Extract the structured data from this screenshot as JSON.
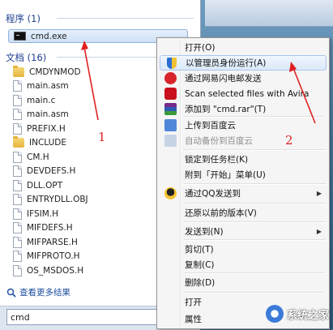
{
  "start_menu": {
    "programs_header": "程序 (1)",
    "programs": [
      {
        "label": "cmd.exe",
        "icon": "cmd-icon"
      }
    ],
    "documents_header": "文档 (16)",
    "documents": [
      {
        "label": "CMDYNMOD",
        "icon": "folder-icon"
      },
      {
        "label": "main.asm",
        "icon": "file-icon"
      },
      {
        "label": "main.c",
        "icon": "file-icon"
      },
      {
        "label": "main.asm",
        "icon": "file-icon"
      },
      {
        "label": "PREFIX.H",
        "icon": "file-icon"
      },
      {
        "label": "INCLUDE",
        "icon": "folder-icon"
      },
      {
        "label": "CM.H",
        "icon": "file-icon"
      },
      {
        "label": "DEVDEFS.H",
        "icon": "file-icon"
      },
      {
        "label": "DLL.OPT",
        "icon": "file-icon"
      },
      {
        "label": "ENTRYDLL.OBJ",
        "icon": "file-icon"
      },
      {
        "label": "IFSIM.H",
        "icon": "file-icon"
      },
      {
        "label": "MIFDEFS.H",
        "icon": "file-icon"
      },
      {
        "label": "MIFPARSE.H",
        "icon": "file-icon"
      },
      {
        "label": "MIFPROTO.H",
        "icon": "file-icon"
      },
      {
        "label": "OS_MSDOS.H",
        "icon": "file-icon"
      }
    ],
    "more_results": "查看更多结果",
    "search_value": "cmd",
    "search_clear": "×"
  },
  "context_menu": {
    "items": [
      {
        "label": "打开(O)",
        "icon": ""
      },
      {
        "label": "以管理员身份运行(A)",
        "icon": "uac-shield-icon"
      },
      {
        "label": "通过网易闪电邮发送",
        "icon": "netease-mail-icon"
      },
      {
        "label": "Scan selected files with Avira",
        "icon": "avira-icon"
      },
      {
        "label": "添加到 \"cmd.rar\"(T)",
        "icon": "winrar-icon"
      },
      {
        "label": "上传到百度云",
        "icon": "baidu-cloud-icon"
      },
      {
        "label": "自动备份到百度云",
        "icon": "baidu-cloud-icon",
        "disabled": true
      },
      {
        "label": "锁定到任务栏(K)",
        "icon": ""
      },
      {
        "label": "附到「开始」菜单(U)",
        "icon": ""
      },
      {
        "label": "通过QQ发送到",
        "icon": "qq-icon",
        "submenu": true
      },
      {
        "label": "还原以前的版本(V)",
        "icon": ""
      },
      {
        "label": "发送到(N)",
        "icon": "",
        "submenu": true
      },
      {
        "label": "剪切(T)",
        "icon": ""
      },
      {
        "label": "复制(C)",
        "icon": ""
      },
      {
        "label": "删除(D)",
        "icon": ""
      },
      {
        "label": "打开",
        "icon": ""
      },
      {
        "label": "属性",
        "icon": ""
      }
    ],
    "submenu_arrow": "▶"
  },
  "annotations": {
    "label_1": "1",
    "label_2": "2",
    "color": "#e02020"
  },
  "watermark": {
    "text": "系统之家"
  }
}
